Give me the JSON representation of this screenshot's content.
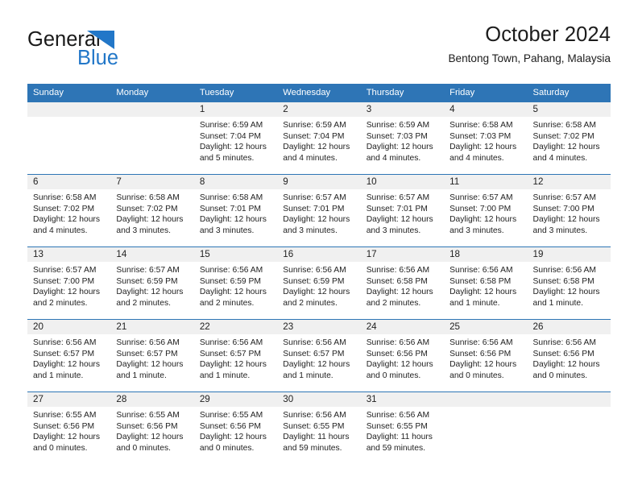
{
  "brand": {
    "name_dark": "General",
    "name_blue": "Blue",
    "logo_icon": "general-blue-triangle-logo",
    "dark_color": "#1a1a1a",
    "blue_color": "#2277c8"
  },
  "header": {
    "title": "October 2024",
    "subtitle": "Bentong Town, Pahang, Malaysia"
  },
  "colors": {
    "header_blue": "#2e75b6",
    "daynum_strip": "#f0f0f0",
    "text": "#222222"
  },
  "weekday_headers": [
    "Sunday",
    "Monday",
    "Tuesday",
    "Wednesday",
    "Thursday",
    "Friday",
    "Saturday"
  ],
  "labels": {
    "sunrise_prefix": "Sunrise:",
    "sunset_prefix": "Sunset:",
    "daylight_prefix": "Daylight:"
  },
  "weeks": [
    [
      {
        "day": "",
        "empty": true
      },
      {
        "day": "",
        "empty": true
      },
      {
        "day": "1",
        "sunrise": "Sunrise: 6:59 AM",
        "sunset": "Sunset: 7:04 PM",
        "daylight_line1": "Daylight: 12 hours",
        "daylight_line2": "and 5 minutes."
      },
      {
        "day": "2",
        "sunrise": "Sunrise: 6:59 AM",
        "sunset": "Sunset: 7:04 PM",
        "daylight_line1": "Daylight: 12 hours",
        "daylight_line2": "and 4 minutes."
      },
      {
        "day": "3",
        "sunrise": "Sunrise: 6:59 AM",
        "sunset": "Sunset: 7:03 PM",
        "daylight_line1": "Daylight: 12 hours",
        "daylight_line2": "and 4 minutes."
      },
      {
        "day": "4",
        "sunrise": "Sunrise: 6:58 AM",
        "sunset": "Sunset: 7:03 PM",
        "daylight_line1": "Daylight: 12 hours",
        "daylight_line2": "and 4 minutes."
      },
      {
        "day": "5",
        "sunrise": "Sunrise: 6:58 AM",
        "sunset": "Sunset: 7:02 PM",
        "daylight_line1": "Daylight: 12 hours",
        "daylight_line2": "and 4 minutes."
      }
    ],
    [
      {
        "day": "6",
        "sunrise": "Sunrise: 6:58 AM",
        "sunset": "Sunset: 7:02 PM",
        "daylight_line1": "Daylight: 12 hours",
        "daylight_line2": "and 4 minutes."
      },
      {
        "day": "7",
        "sunrise": "Sunrise: 6:58 AM",
        "sunset": "Sunset: 7:02 PM",
        "daylight_line1": "Daylight: 12 hours",
        "daylight_line2": "and 3 minutes."
      },
      {
        "day": "8",
        "sunrise": "Sunrise: 6:58 AM",
        "sunset": "Sunset: 7:01 PM",
        "daylight_line1": "Daylight: 12 hours",
        "daylight_line2": "and 3 minutes."
      },
      {
        "day": "9",
        "sunrise": "Sunrise: 6:57 AM",
        "sunset": "Sunset: 7:01 PM",
        "daylight_line1": "Daylight: 12 hours",
        "daylight_line2": "and 3 minutes."
      },
      {
        "day": "10",
        "sunrise": "Sunrise: 6:57 AM",
        "sunset": "Sunset: 7:01 PM",
        "daylight_line1": "Daylight: 12 hours",
        "daylight_line2": "and 3 minutes."
      },
      {
        "day": "11",
        "sunrise": "Sunrise: 6:57 AM",
        "sunset": "Sunset: 7:00 PM",
        "daylight_line1": "Daylight: 12 hours",
        "daylight_line2": "and 3 minutes."
      },
      {
        "day": "12",
        "sunrise": "Sunrise: 6:57 AM",
        "sunset": "Sunset: 7:00 PM",
        "daylight_line1": "Daylight: 12 hours",
        "daylight_line2": "and 3 minutes."
      }
    ],
    [
      {
        "day": "13",
        "sunrise": "Sunrise: 6:57 AM",
        "sunset": "Sunset: 7:00 PM",
        "daylight_line1": "Daylight: 12 hours",
        "daylight_line2": "and 2 minutes."
      },
      {
        "day": "14",
        "sunrise": "Sunrise: 6:57 AM",
        "sunset": "Sunset: 6:59 PM",
        "daylight_line1": "Daylight: 12 hours",
        "daylight_line2": "and 2 minutes."
      },
      {
        "day": "15",
        "sunrise": "Sunrise: 6:56 AM",
        "sunset": "Sunset: 6:59 PM",
        "daylight_line1": "Daylight: 12 hours",
        "daylight_line2": "and 2 minutes."
      },
      {
        "day": "16",
        "sunrise": "Sunrise: 6:56 AM",
        "sunset": "Sunset: 6:59 PM",
        "daylight_line1": "Daylight: 12 hours",
        "daylight_line2": "and 2 minutes."
      },
      {
        "day": "17",
        "sunrise": "Sunrise: 6:56 AM",
        "sunset": "Sunset: 6:58 PM",
        "daylight_line1": "Daylight: 12 hours",
        "daylight_line2": "and 2 minutes."
      },
      {
        "day": "18",
        "sunrise": "Sunrise: 6:56 AM",
        "sunset": "Sunset: 6:58 PM",
        "daylight_line1": "Daylight: 12 hours",
        "daylight_line2": "and 1 minute."
      },
      {
        "day": "19",
        "sunrise": "Sunrise: 6:56 AM",
        "sunset": "Sunset: 6:58 PM",
        "daylight_line1": "Daylight: 12 hours",
        "daylight_line2": "and 1 minute."
      }
    ],
    [
      {
        "day": "20",
        "sunrise": "Sunrise: 6:56 AM",
        "sunset": "Sunset: 6:57 PM",
        "daylight_line1": "Daylight: 12 hours",
        "daylight_line2": "and 1 minute."
      },
      {
        "day": "21",
        "sunrise": "Sunrise: 6:56 AM",
        "sunset": "Sunset: 6:57 PM",
        "daylight_line1": "Daylight: 12 hours",
        "daylight_line2": "and 1 minute."
      },
      {
        "day": "22",
        "sunrise": "Sunrise: 6:56 AM",
        "sunset": "Sunset: 6:57 PM",
        "daylight_line1": "Daylight: 12 hours",
        "daylight_line2": "and 1 minute."
      },
      {
        "day": "23",
        "sunrise": "Sunrise: 6:56 AM",
        "sunset": "Sunset: 6:57 PM",
        "daylight_line1": "Daylight: 12 hours",
        "daylight_line2": "and 1 minute."
      },
      {
        "day": "24",
        "sunrise": "Sunrise: 6:56 AM",
        "sunset": "Sunset: 6:56 PM",
        "daylight_line1": "Daylight: 12 hours",
        "daylight_line2": "and 0 minutes."
      },
      {
        "day": "25",
        "sunrise": "Sunrise: 6:56 AM",
        "sunset": "Sunset: 6:56 PM",
        "daylight_line1": "Daylight: 12 hours",
        "daylight_line2": "and 0 minutes."
      },
      {
        "day": "26",
        "sunrise": "Sunrise: 6:56 AM",
        "sunset": "Sunset: 6:56 PM",
        "daylight_line1": "Daylight: 12 hours",
        "daylight_line2": "and 0 minutes."
      }
    ],
    [
      {
        "day": "27",
        "sunrise": "Sunrise: 6:55 AM",
        "sunset": "Sunset: 6:56 PM",
        "daylight_line1": "Daylight: 12 hours",
        "daylight_line2": "and 0 minutes."
      },
      {
        "day": "28",
        "sunrise": "Sunrise: 6:55 AM",
        "sunset": "Sunset: 6:56 PM",
        "daylight_line1": "Daylight: 12 hours",
        "daylight_line2": "and 0 minutes."
      },
      {
        "day": "29",
        "sunrise": "Sunrise: 6:55 AM",
        "sunset": "Sunset: 6:56 PM",
        "daylight_line1": "Daylight: 12 hours",
        "daylight_line2": "and 0 minutes."
      },
      {
        "day": "30",
        "sunrise": "Sunrise: 6:56 AM",
        "sunset": "Sunset: 6:55 PM",
        "daylight_line1": "Daylight: 11 hours",
        "daylight_line2": "and 59 minutes."
      },
      {
        "day": "31",
        "sunrise": "Sunrise: 6:56 AM",
        "sunset": "Sunset: 6:55 PM",
        "daylight_line1": "Daylight: 11 hours",
        "daylight_line2": "and 59 minutes."
      },
      {
        "day": "",
        "empty": true
      },
      {
        "day": "",
        "empty": true
      }
    ]
  ]
}
